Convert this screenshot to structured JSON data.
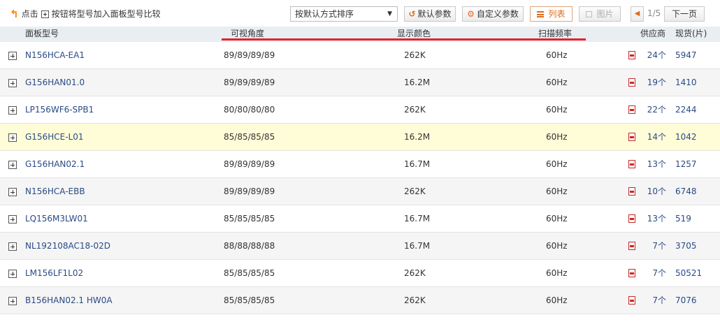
{
  "toolbar": {
    "hint_prefix": "点击",
    "hint_suffix": "按钮将型号加入面板型号比较",
    "sort_value": "按默认方式排序",
    "default_params": "默认参数",
    "custom_params": "自定义参数",
    "list_view": "列表",
    "pic_view": "图片",
    "page": "1/5",
    "next_page": "下一页"
  },
  "columns": {
    "model": "面板型号",
    "angle": "可视角度",
    "color": "显示颜色",
    "freq": "扫描频率",
    "supplier": "供应商",
    "stock": "现货(片)"
  },
  "rows": [
    {
      "model": "N156HCA-EA1",
      "angle": "89/89/89/89",
      "color": "262K",
      "freq": "60Hz",
      "supplier": "24个",
      "stock": "5947"
    },
    {
      "model": "G156HAN01.0",
      "angle": "89/89/89/89",
      "color": "16.2M",
      "freq": "60Hz",
      "supplier": "19个",
      "stock": "1410"
    },
    {
      "model": "LP156WF6-SPB1",
      "angle": "80/80/80/80",
      "color": "262K",
      "freq": "60Hz",
      "supplier": "22个",
      "stock": "2244"
    },
    {
      "model": "G156HCE-L01",
      "angle": "85/85/85/85",
      "color": "16.2M",
      "freq": "60Hz",
      "supplier": "14个",
      "stock": "1042"
    },
    {
      "model": "G156HAN02.1",
      "angle": "89/89/89/89",
      "color": "16.7M",
      "freq": "60Hz",
      "supplier": "13个",
      "stock": "1257"
    },
    {
      "model": "N156HCA-EBB",
      "angle": "89/89/89/89",
      "color": "262K",
      "freq": "60Hz",
      "supplier": "10个",
      "stock": "6748"
    },
    {
      "model": "LQ156M3LW01",
      "angle": "85/85/85/85",
      "color": "16.7M",
      "freq": "60Hz",
      "supplier": "13个",
      "stock": "519"
    },
    {
      "model": "NL192108AC18-02D",
      "angle": "88/88/88/88",
      "color": "16.7M",
      "freq": "60Hz",
      "supplier": "7个",
      "stock": "3705"
    },
    {
      "model": "LM156LF1L02",
      "angle": "85/85/85/85",
      "color": "262K",
      "freq": "60Hz",
      "supplier": "7个",
      "stock": "50521"
    },
    {
      "model": "B156HAN02.1 HW0A",
      "angle": "85/85/85/85",
      "color": "262K",
      "freq": "60Hz",
      "supplier": "7个",
      "stock": "7076"
    }
  ]
}
